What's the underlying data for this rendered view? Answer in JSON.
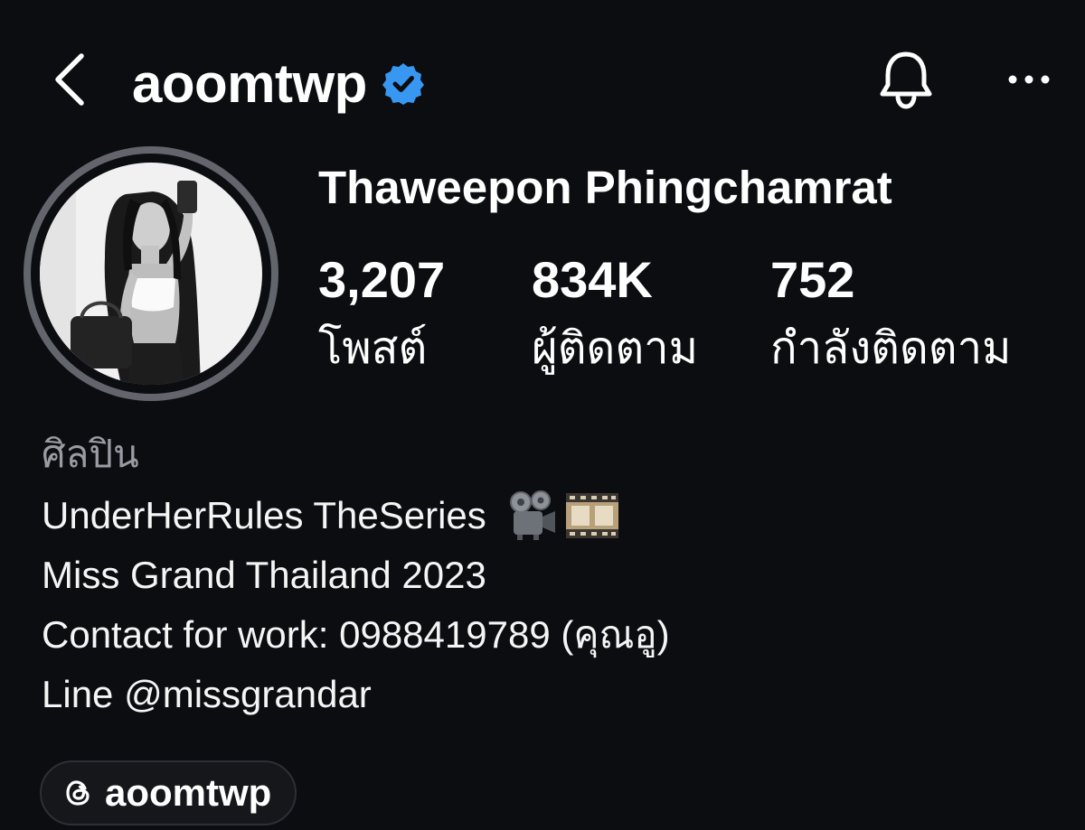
{
  "header": {
    "username": "aoomtwp",
    "verified": true,
    "accent_color": "#3897f0",
    "icons": {
      "back": "chevron-left-icon",
      "notifications": "bell-icon",
      "more": "more-horizontal-icon",
      "verified": "verified-badge-icon"
    }
  },
  "profile": {
    "full_name": "Thaweepon Phingchamrat",
    "stats": [
      {
        "value": "3,207",
        "label": "โพสต์"
      },
      {
        "value": "834K",
        "label": "ผู้ติดตาม"
      },
      {
        "value": "752",
        "label": "กำลังติดตาม"
      }
    ]
  },
  "bio": {
    "category": "ศิลปิน",
    "lines": [
      "UnderHerRules TheSeries",
      "Miss Grand Thailand 2023",
      "Contact for work: 0988419789 (คุณอู)",
      "Line @missgrandar"
    ],
    "line1_emojis": [
      "movie-camera-icon",
      "film-frames-icon"
    ]
  },
  "threads_link": {
    "icon": "threads-icon",
    "label": "aoomtwp"
  },
  "colors": {
    "background": "#0b0d10",
    "avatar_ring": "#62656c",
    "category_text": "#9a9ca3"
  }
}
